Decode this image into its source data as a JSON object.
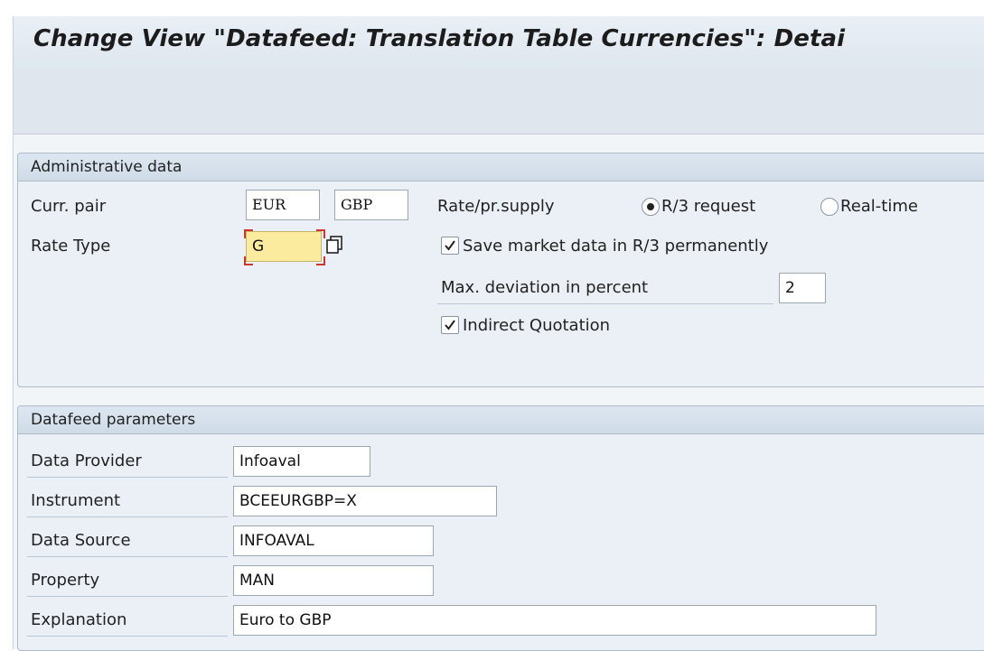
{
  "window": {
    "title": "Change View \"Datafeed: Translation Table Currencies\": Detai"
  },
  "admin_group": {
    "header": "Administrative data",
    "curr_pair": {
      "label": "Curr. pair",
      "from": "EUR",
      "to": "GBP"
    },
    "rate_type": {
      "label": "Rate Type",
      "value": "G"
    },
    "rate_supply": {
      "label": "Rate/pr.supply",
      "options": [
        "R/3 request",
        "Real-time"
      ],
      "selected": "R/3 request"
    },
    "save_market_data": {
      "label": "Save market data in R/3 permanently",
      "checked": true
    },
    "max_deviation": {
      "label": "Max. deviation in percent",
      "value": "2"
    },
    "indirect_quotation": {
      "label": "Indirect Quotation",
      "checked": true
    }
  },
  "datafeed_group": {
    "header": "Datafeed parameters",
    "data_provider": {
      "label": "Data Provider",
      "value": "Infoaval"
    },
    "instrument": {
      "label": "Instrument",
      "value": "BCEEURGBP=X"
    },
    "data_source": {
      "label": "Data Source",
      "value": "INFOAVAL"
    },
    "property": {
      "label": "Property",
      "value": "MAN"
    },
    "explanation": {
      "label": "Explanation",
      "value": "Euro to GBP"
    }
  },
  "icons": {
    "f4_help": "value-help-icon",
    "checkmark": "checkmark-icon"
  }
}
